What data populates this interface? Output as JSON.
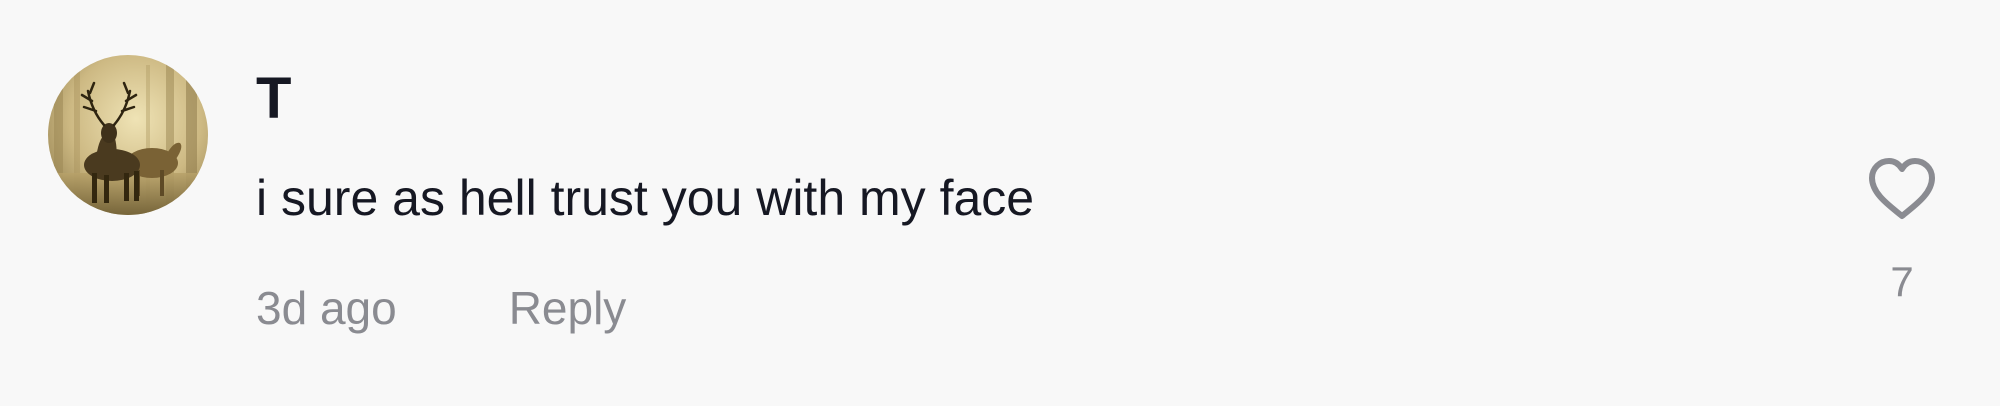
{
  "comment": {
    "username": "T",
    "text": "i sure as hell trust you with my face",
    "timestamp": "3d ago",
    "reply_label": "Reply",
    "like_count": "7"
  },
  "avatar": {
    "description_icon": "deer-photo"
  },
  "icons": {
    "like": "heart-outline-icon"
  },
  "colors": {
    "background": "#f8f8f8",
    "primary_text": "#161823",
    "secondary_text": "#8a8b91"
  }
}
